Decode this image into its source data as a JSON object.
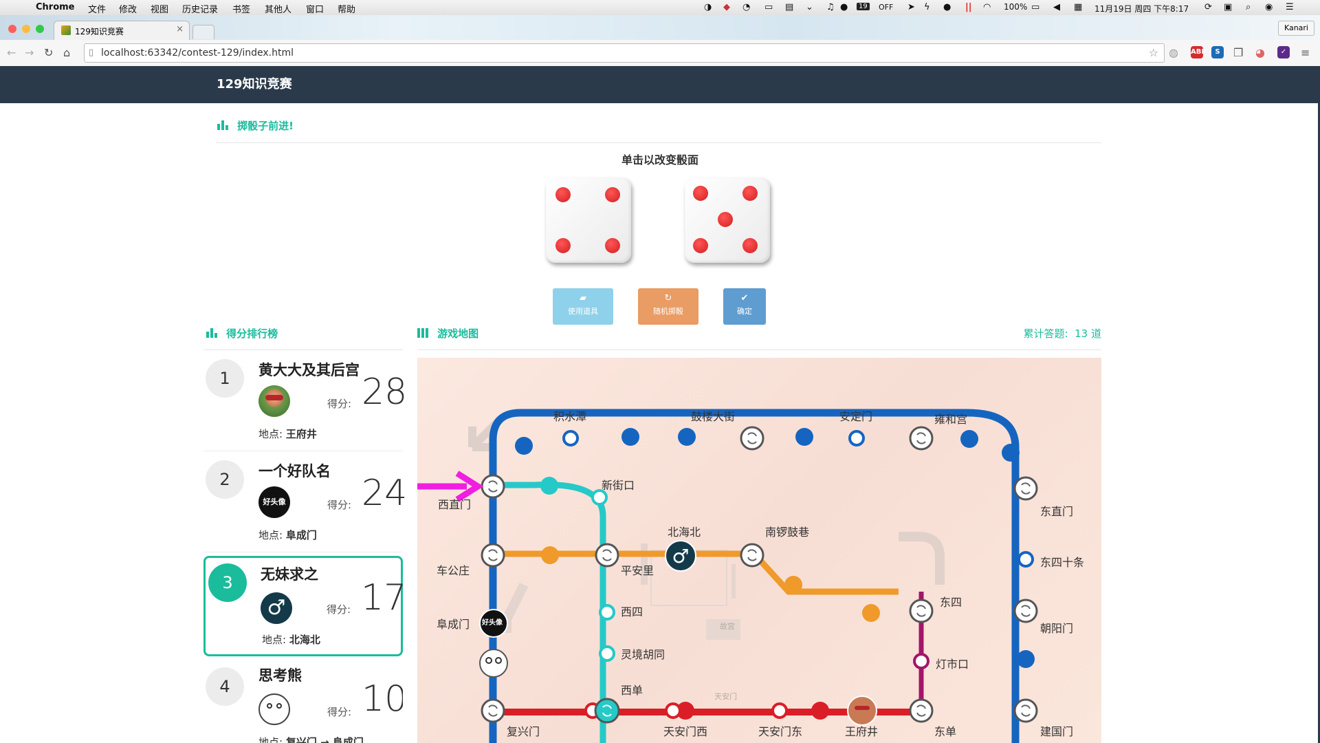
{
  "os": {
    "menu": [
      "Chrome",
      "文件",
      "修改",
      "视图",
      "历史记录",
      "书签",
      "其他人",
      "窗口",
      "帮助"
    ],
    "status": {
      "badge": "19",
      "off": "OFF",
      "battery": "100%",
      "datetime": "11月19日 周四 下午8:17"
    }
  },
  "browser": {
    "tab_title": "129知识竞赛",
    "url": "localhost:63342/contest-129/index.html",
    "profile": "Kanari",
    "extensions": [
      {
        "name": "adblock",
        "label": "ABP",
        "color": "#d62c2c"
      },
      {
        "name": "s-ext",
        "label": "S",
        "color": "#1c6bb6"
      },
      {
        "name": "v-ext",
        "label": "✓",
        "color": "#5b2b8a"
      }
    ]
  },
  "app": {
    "title": "129知识竞赛"
  },
  "dice_panel": {
    "title": "掷骰子前进!",
    "hint": "单击以改变骰面",
    "dice": [
      4,
      5
    ],
    "buttons": [
      {
        "label": "使用道具",
        "icon": "briefcase-icon",
        "glyph": "▰",
        "color": "#8fd1ea"
      },
      {
        "label": "随机掷骰",
        "icon": "refresh-icon",
        "glyph": "↻",
        "color": "#e99c64"
      },
      {
        "label": "确定",
        "icon": "check-icon",
        "glyph": "✔",
        "color": "#5f9dd0"
      }
    ]
  },
  "leaderboard": {
    "title": "得分排行榜",
    "score_label": "得分:",
    "location_label": "地点:",
    "teams": [
      {
        "rank": "1",
        "name": "黄大大及其后宫",
        "score": "28",
        "location": "王府井",
        "avatar": "photo",
        "active": false
      },
      {
        "rank": "2",
        "name": "一个好队名",
        "score": "24",
        "location": "阜成门",
        "avatar": "logo",
        "logo_text": "好头像",
        "active": false
      },
      {
        "rank": "3",
        "name": "无妹求之",
        "score": "17",
        "location": "北海北",
        "avatar": "male",
        "active": true
      },
      {
        "rank": "4",
        "name": "思考熊",
        "score": "10",
        "location": "复兴门 → 阜成门",
        "avatar": "bear",
        "active": false
      }
    ]
  },
  "map": {
    "title": "游戏地图",
    "total_label": "累计答题:",
    "total_value": "13 道",
    "center_labels": [
      "故宫",
      "天安门"
    ],
    "stations": {
      "jishuitan": "积水潭",
      "gulou": "鼓楼大街",
      "andingmen": "安定门",
      "yonghegong": "雍和宫",
      "xizhimen": "西直门",
      "xinjiekou": "新街口",
      "dongzhimen": "东直门",
      "beihaibei": "北海北",
      "nanluoguxiang": "南锣鼓巷",
      "chegongzhuang": "车公庄",
      "pinganli": "平安里",
      "dongsishitiao": "东四十条",
      "dongsi": "东四",
      "fuchengmen": "阜成门",
      "xisi": "西四",
      "chaoyangmen": "朝阳门",
      "lingjing": "灵境胡同",
      "dengshikou": "灯市口",
      "xidan": "西单",
      "fuxingmen": "复兴门",
      "tiananmenxi": "天安门西",
      "tiananmendong": "天安门东",
      "wangfujing": "王府井",
      "dongdan": "东单",
      "jianguomen": "建国门"
    }
  }
}
